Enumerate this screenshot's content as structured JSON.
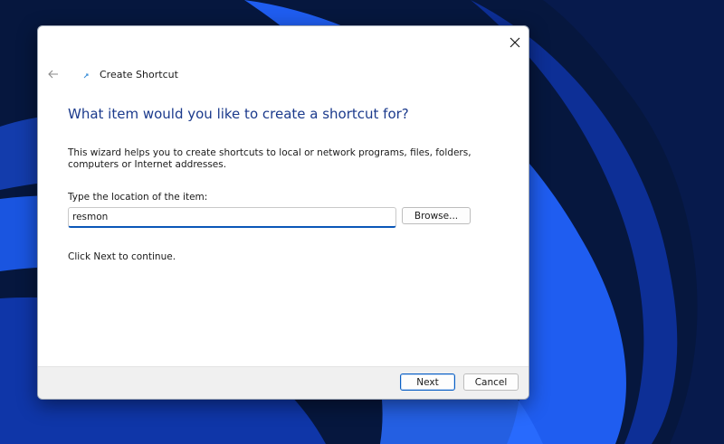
{
  "window": {
    "title": "Create Shortcut"
  },
  "wizard": {
    "heading": "What item would you like to create a shortcut for?",
    "description": "This wizard helps you to create shortcuts to local or network programs, files, folders, computers or Internet addresses.",
    "location_label": "Type the location of the item:",
    "location_value": "resmon",
    "browse_label": "Browse...",
    "continue_text": "Click Next to continue."
  },
  "footer": {
    "next_label": "Next",
    "cancel_label": "Cancel"
  },
  "colors": {
    "accent": "#0a57b8",
    "heading": "#1b3a8c",
    "wallpaper_dark": "#06173e",
    "wallpaper_blue": "#1a56e6"
  },
  "icons": {
    "close": "close-icon",
    "back": "back-arrow-icon",
    "app": "shortcut-app-icon"
  }
}
